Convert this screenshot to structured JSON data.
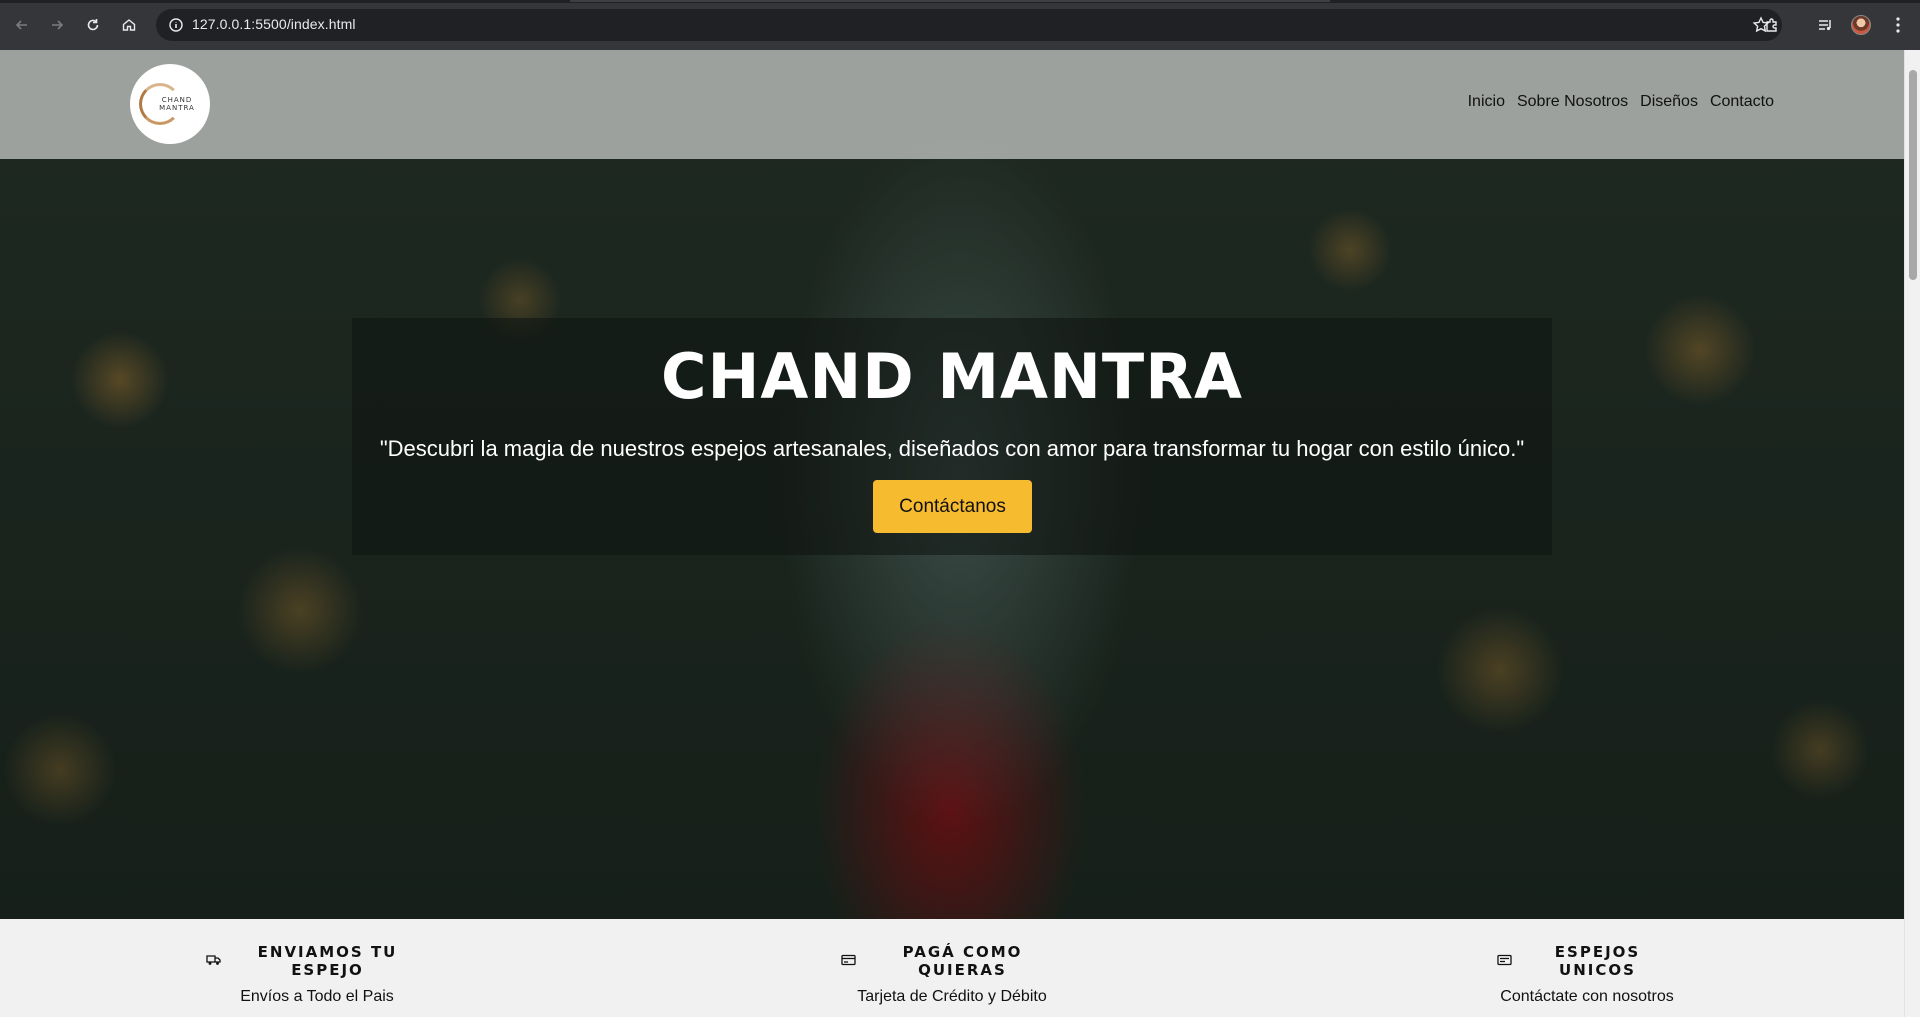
{
  "browser": {
    "url": "127.0.0.1:5500/index.html",
    "icons": [
      "back-icon",
      "forward-icon",
      "reload-icon",
      "home-icon",
      "site-info-icon",
      "bookmark-star-icon",
      "extensions-icon",
      "media-list-icon",
      "profile-avatar",
      "menu-kebab-icon"
    ]
  },
  "header": {
    "logo_line1": "CHAND",
    "logo_line2": "MANTRA",
    "nav": [
      "Inicio",
      "Sobre Nosotros",
      "Diseños",
      "Contacto"
    ]
  },
  "hero": {
    "title": "CHAND MANTRA",
    "subtitle": "\"Descubri la magia de nuestros espejos artesanales, diseñados con amor para transformar tu hogar con estilo único.\"",
    "cta": "Contáctanos"
  },
  "features": [
    {
      "icon": "truck-icon",
      "title": "ENVIAMOS TU ESPEJO",
      "text": "Envíos a Todo el Pais"
    },
    {
      "icon": "credit-card-icon",
      "title": "PAGÁ COMO QUIERAS",
      "text": "Tarjeta de Crédito y Débito"
    },
    {
      "icon": "card-icon",
      "title": "ESPEJOS UNICOS",
      "text": "Contáctate con nosotros"
    }
  ],
  "colors": {
    "accent": "#f7bb2f",
    "chrome": "#35363a",
    "omnibox": "#202124",
    "features_bg": "#f1f1f1"
  }
}
